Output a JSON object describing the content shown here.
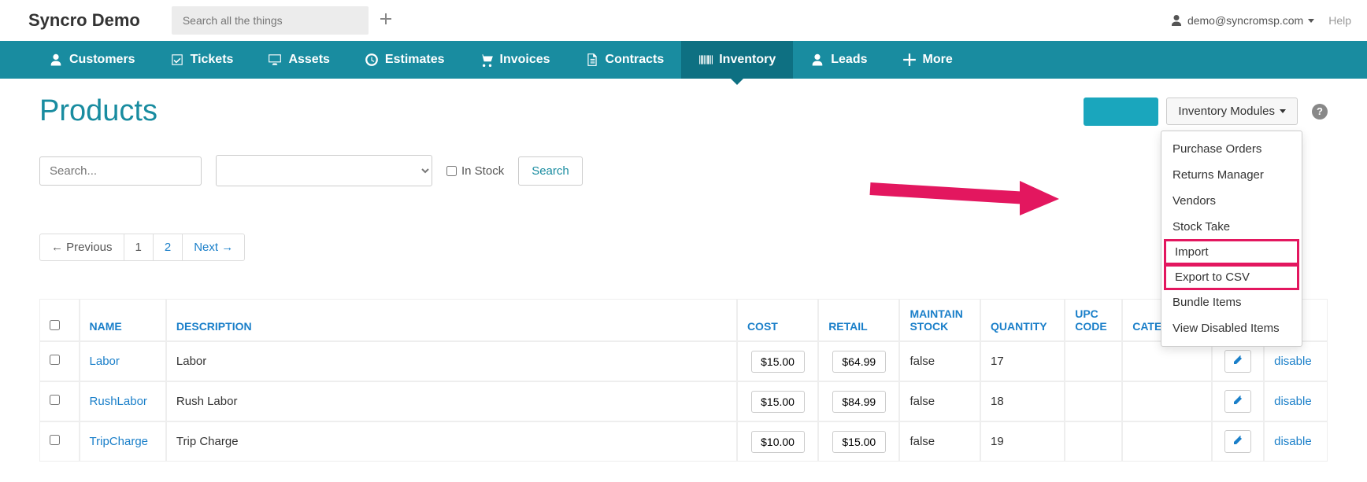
{
  "brand": "Syncro Demo",
  "search_placeholder": "Search all the things",
  "user_email": "demo@syncromsp.com",
  "help_label": "Help",
  "nav": [
    {
      "label": "Customers",
      "icon": "person"
    },
    {
      "label": "Tickets",
      "icon": "check-square"
    },
    {
      "label": "Assets",
      "icon": "desktop"
    },
    {
      "label": "Estimates",
      "icon": "time"
    },
    {
      "label": "Invoices",
      "icon": "cart"
    },
    {
      "label": "Contracts",
      "icon": "file"
    },
    {
      "label": "Inventory",
      "icon": "barcode",
      "active": true
    },
    {
      "label": "Leads",
      "icon": "person"
    },
    {
      "label": "More",
      "icon": "plus"
    }
  ],
  "page_title": "Products",
  "inv_modules_label": "Inventory Modules",
  "dropdown": [
    {
      "label": "Purchase Orders"
    },
    {
      "label": "Returns Manager"
    },
    {
      "label": "Vendors"
    },
    {
      "label": "Stock Take"
    },
    {
      "label": "Import",
      "highlight": true
    },
    {
      "label": "Export to CSV",
      "highlight": true
    },
    {
      "label": "Bundle Items"
    },
    {
      "label": "View Disabled Items"
    }
  ],
  "filters": {
    "search_placeholder": "Search...",
    "in_stock_label": "In Stock",
    "search_btn": "Search"
  },
  "pagination": {
    "prev": "← Previous",
    "pages": [
      "1",
      "2"
    ],
    "next": "Next →"
  },
  "columns": [
    "NAME",
    "DESCRIPTION",
    "COST",
    "RETAIL",
    "MAINTAIN STOCK",
    "QUANTITY",
    "UPC CODE",
    "CATEGORY"
  ],
  "disable_label": "disable",
  "rows": [
    {
      "name": "Labor",
      "desc": "Labor",
      "cost": "$15.00",
      "retail": "$64.99",
      "maintain": "false",
      "qty": "17"
    },
    {
      "name": "RushLabor",
      "desc": "Rush Labor",
      "cost": "$15.00",
      "retail": "$84.99",
      "maintain": "false",
      "qty": "18"
    },
    {
      "name": "TripCharge",
      "desc": "Trip Charge",
      "cost": "$10.00",
      "retail": "$15.00",
      "maintain": "false",
      "qty": "19"
    }
  ]
}
